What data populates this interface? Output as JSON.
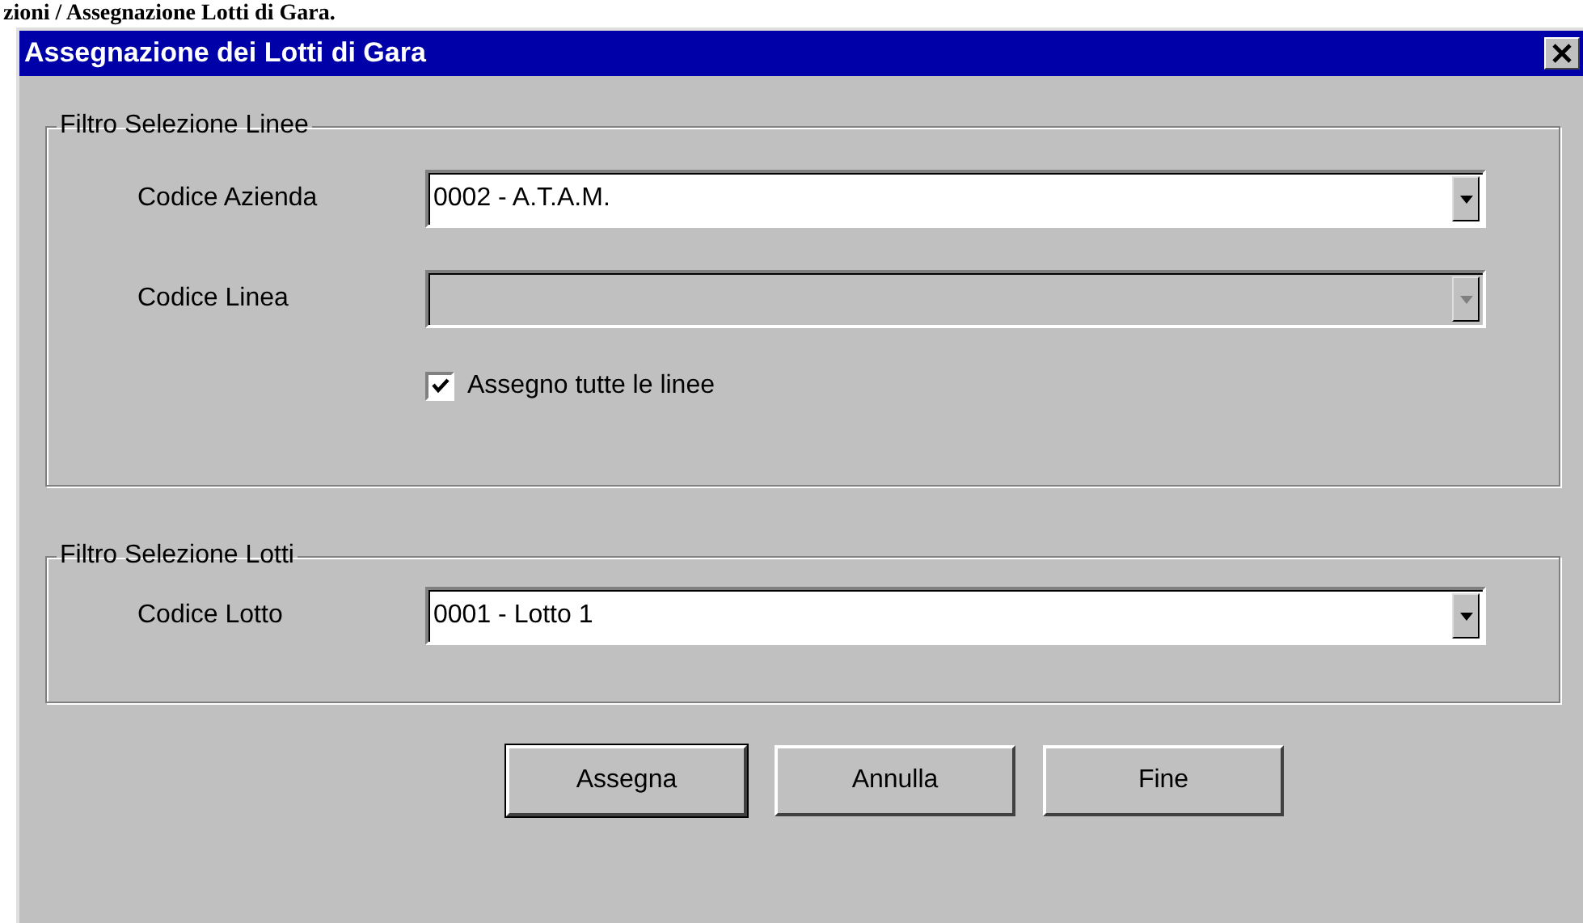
{
  "heading": "zioni / Assegnazione Lotti di Gara.",
  "window": {
    "title": "Assegnazione dei Lotti di Gara"
  },
  "groups": [
    {
      "legend": "Filtro Selezione Linee",
      "rows": [
        {
          "kind": "combo",
          "label": "Codice Azienda",
          "value": "0002 - A.T.A.M.",
          "disabled": false
        },
        {
          "kind": "combo",
          "label": "Codice Linea",
          "disabled": true
        },
        {
          "kind": "checkbox",
          "label": "Assegno tutte le linee",
          "checked": true
        }
      ]
    },
    {
      "legend": "Filtro Selezione Lotti",
      "rows": [
        {
          "kind": "combo",
          "label": "Codice Lotto",
          "value": "0001 - Lotto 1",
          "disabled": false
        }
      ]
    }
  ],
  "buttons": [
    {
      "label": "Assegna",
      "default": true
    },
    {
      "label": "Annulla",
      "default": false
    },
    {
      "label": "Fine",
      "default": false
    }
  ]
}
